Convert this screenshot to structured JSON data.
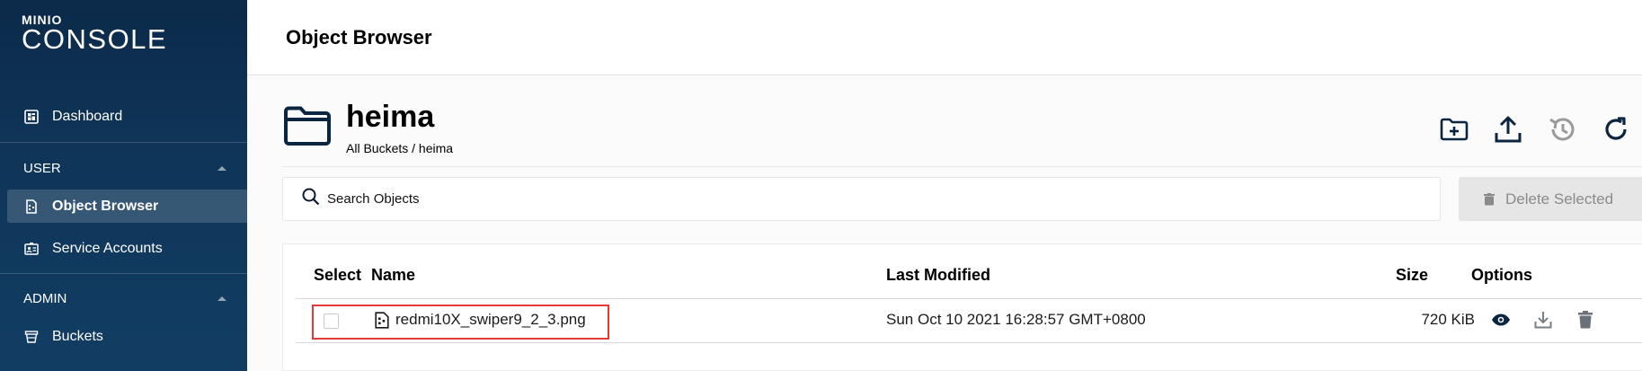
{
  "brand": {
    "small": "MINIO",
    "big": "CONSOLE"
  },
  "sidebar": {
    "dashboard": "Dashboard",
    "user_section": "USER",
    "object_browser": "Object Browser",
    "service_accounts": "Service Accounts",
    "admin_section": "ADMIN",
    "buckets": "Buckets"
  },
  "header": {
    "title": "Object Browser"
  },
  "bucket": {
    "name": "heima",
    "breadcrumb": "All Buckets / heima",
    "actions": [
      "create-folder-icon",
      "upload-icon",
      "rewind-icon",
      "refresh-icon"
    ]
  },
  "search": {
    "placeholder": "Search Objects"
  },
  "delete_selected": "Delete Selected",
  "table": {
    "columns": {
      "select": "Select",
      "name": "Name",
      "last_modified": "Last Modified",
      "size": "Size",
      "options": "Options"
    },
    "rows": [
      {
        "name": "redmi10X_swiper9_2_3.png",
        "last_modified": "Sun Oct 10 2021 16:28:57 GMT+0800",
        "size": "720 KiB",
        "selected": false
      }
    ]
  },
  "colors": {
    "sidebar": "#0f3659",
    "highlight": "#e53935",
    "icon": "#0a2540"
  }
}
